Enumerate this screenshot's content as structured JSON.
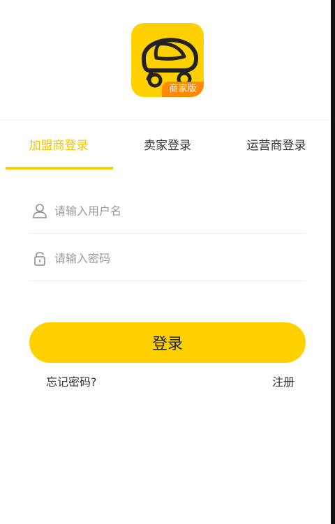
{
  "logo": {
    "badge": "商家版",
    "icon": "car-logo-icon"
  },
  "tabs": [
    {
      "label": "加盟商登录",
      "active": true
    },
    {
      "label": "卖家登录",
      "active": false
    },
    {
      "label": "运营商登录",
      "active": false
    }
  ],
  "form": {
    "username_placeholder": "请输入用户名",
    "password_placeholder": "请输入密码"
  },
  "login_label": "登录",
  "forgot_label": "忘记密码?",
  "register_label": "注册",
  "colors": {
    "accent": "#FFD000",
    "badge": "#FF8A00",
    "active_tab": "#F2C500"
  }
}
